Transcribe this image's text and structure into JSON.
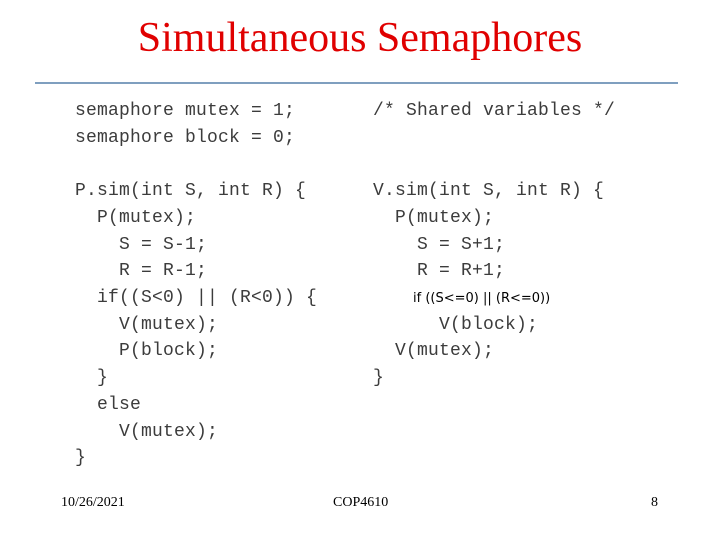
{
  "slide": {
    "title": "Simultaneous Semaphores",
    "title_color": "#e00000",
    "rule_color": "#7f9fbf"
  },
  "code_left": {
    "decl": [
      "semaphore mutex = 1;",
      "semaphore block = 0;"
    ],
    "psim": [
      "P.sim(int S, int R) {",
      "  P(mutex);",
      "    S = S-1;",
      "    R = R-1;",
      "  if((S<0) || (R<0)) {",
      "    V(mutex);",
      "    P(block);",
      "  }",
      "  else",
      "    V(mutex);",
      "}"
    ]
  },
  "code_right": {
    "comment": "/* Shared variables */",
    "vsim": [
      "V.sim(int S, int R) {",
      "  P(mutex);",
      "    S = S+1;",
      "    R = R+1;",
      "",
      "      V(block);",
      "  V(mutex);",
      "}"
    ],
    "inserted_condition": "if ((S<=0) || (R<=0))"
  },
  "footer": {
    "date": "10/26/2021",
    "course": "COP4610",
    "page_number": "8"
  }
}
